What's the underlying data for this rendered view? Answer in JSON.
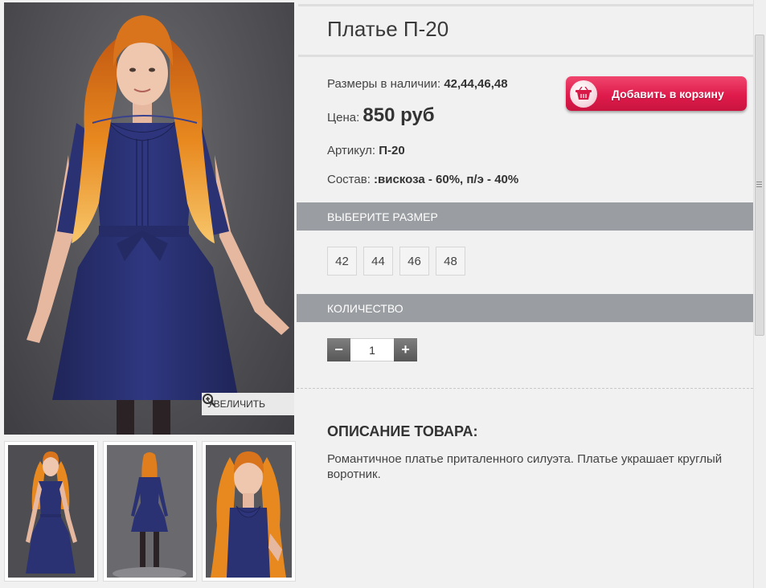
{
  "product": {
    "title": "Платье П-20",
    "sizes_label": "Размеры в наличии:",
    "sizes_value": "42,44,46,48",
    "price_label": "Цена:",
    "price_value": "850 руб",
    "article_label": "Артикул:",
    "article_value": "П-20",
    "composition_label": "Состав:",
    "composition_value": ":вискоза - 60%, п/э - 40%"
  },
  "cart_button": {
    "label": "Добавить в корзину",
    "icon": "shopping-basket-icon"
  },
  "gallery": {
    "zoom_label": "УВЕЛИЧИТЬ",
    "zoom_icon": "magnifier-plus-icon",
    "thumbnails": [
      "front view",
      "back view",
      "close-up view"
    ]
  },
  "size_section": {
    "header": "ВЫБЕРИТЕ РАЗМЕР",
    "options": [
      "42",
      "44",
      "46",
      "48"
    ]
  },
  "quantity_section": {
    "header": "КОЛИЧЕСТВО",
    "minus": "−",
    "plus": "+",
    "value": "1"
  },
  "description": {
    "title": "ОПИСАНИЕ ТОВАРА:",
    "text": "Романтичное платье приталенного силуэта. Платье украшает круглый воротник."
  },
  "colors": {
    "background": "#f1f1f1",
    "section_bar": "#9a9da1",
    "cart_button": "#df1b4c",
    "dress": "#2b3273",
    "hair": "#e8891f"
  }
}
